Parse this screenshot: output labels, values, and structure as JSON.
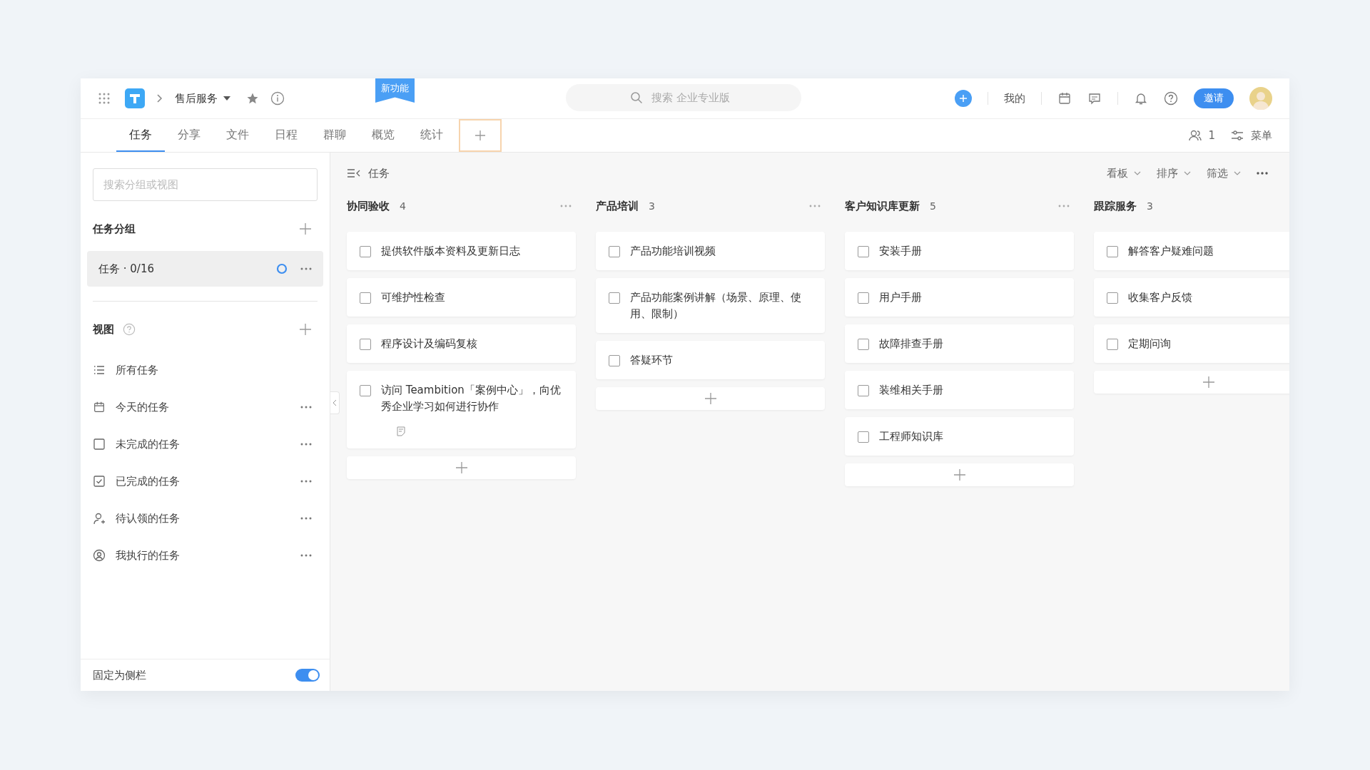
{
  "topbar": {
    "project": "售后服务",
    "badge": "新功能",
    "search": {
      "placeholder": "搜索 企业专业版"
    },
    "mine": "我的",
    "invite": "邀请"
  },
  "tabs": [
    {
      "label": "任务",
      "selected": true
    },
    {
      "label": "分享",
      "selected": false
    },
    {
      "label": "文件",
      "selected": false
    },
    {
      "label": "日程",
      "selected": false
    },
    {
      "label": "群聊",
      "selected": false
    },
    {
      "label": "概览",
      "selected": false
    },
    {
      "label": "统计",
      "selected": false
    }
  ],
  "add_tab": {
    "highlighted": true
  },
  "tabbar_right": {
    "members": "1",
    "menu": "菜单"
  },
  "sidebar": {
    "search": {
      "placeholder": "搜索分组或视图"
    },
    "groups_title": "任务分组",
    "groups": [
      {
        "label": "任务 · 0/16",
        "selected": true
      }
    ],
    "views_title": "视图",
    "views": [
      {
        "kind": "list",
        "label": "所有任务",
        "menu": false
      },
      {
        "kind": "calendar",
        "label": "今天的任务",
        "menu": true
      },
      {
        "kind": "open",
        "label": "未完成的任务",
        "menu": true
      },
      {
        "kind": "done",
        "label": "已完成的任务",
        "menu": true
      },
      {
        "kind": "claim",
        "label": "待认领的任务",
        "menu": true
      },
      {
        "kind": "mine",
        "label": "我执行的任务",
        "menu": true
      }
    ],
    "pin": {
      "label": "固定为侧栏",
      "on": true
    }
  },
  "board": {
    "title": "任务",
    "controls": [
      "看板",
      "排序",
      "筛选"
    ],
    "columns": [
      {
        "name": "协同验收",
        "count": "4",
        "cards": [
          {
            "title": "提供软件版本资料及更新日志",
            "checked": false,
            "note": false
          },
          {
            "title": "可维护性检查",
            "checked": false,
            "note": false
          },
          {
            "title": "程序设计及编码复核",
            "checked": false,
            "note": false
          },
          {
            "title": "访问 Teambition「案例中心」，向优秀企业学习如何进行协作",
            "checked": false,
            "note": true
          }
        ]
      },
      {
        "name": "产品培训",
        "count": "3",
        "cards": [
          {
            "title": "产品功能培训视频",
            "checked": false,
            "note": false
          },
          {
            "title": "产品功能案例讲解（场景、原理、使用、限制）",
            "checked": false,
            "note": false
          },
          {
            "title": "答疑环节",
            "checked": false,
            "note": false
          }
        ]
      },
      {
        "name": "客户知识库更新",
        "count": "5",
        "cards": [
          {
            "title": "安装手册",
            "checked": false,
            "note": false
          },
          {
            "title": "用户手册",
            "checked": false,
            "note": false
          },
          {
            "title": "故障排查手册",
            "checked": false,
            "note": false
          },
          {
            "title": "装维相关手册",
            "checked": false,
            "note": false
          },
          {
            "title": "工程师知识库",
            "checked": false,
            "note": false
          }
        ]
      },
      {
        "name": "跟踪服务",
        "count": "3",
        "cards": [
          {
            "title": "解答客户疑难问题",
            "checked": false,
            "note": false
          },
          {
            "title": "收集客户反馈",
            "checked": false,
            "note": false
          },
          {
            "title": "定期问询",
            "checked": false,
            "note": false
          }
        ]
      }
    ]
  }
}
